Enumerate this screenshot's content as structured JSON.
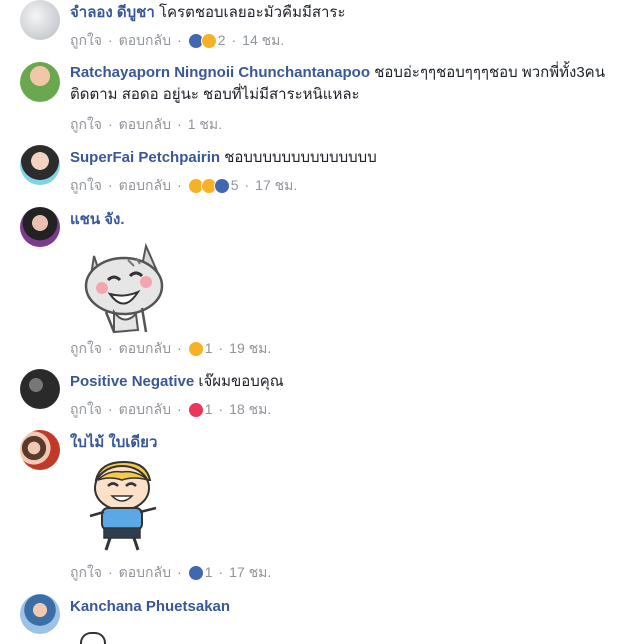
{
  "comments": [
    {
      "name": "จำลอง ดีบูชา",
      "text": "โครตชอบเลยอะมัวคืมมีสาระ",
      "like": "ถูกใจ",
      "reply": "ตอบกลับ",
      "count": "2",
      "time": "14 ชม."
    },
    {
      "name": "Ratchayaporn Ningnoii Chunchantanapoo",
      "text": "ชอบอ่ะๆๆชอบๆๆๆชอบ พวกพี่ทั้ง3คน ติดตาม สอดอ อยู่นะ ชอบที่ไม่มีสาระหนิแหละ",
      "like": "ถูกใจ",
      "reply": "ตอบกลับ",
      "time": "1 ชม."
    },
    {
      "name": "SuperFai Petchpairin",
      "text": "ชอบบบบบบบบบบบบบบ",
      "like": "ถูกใจ",
      "reply": "ตอบกลับ",
      "count": "5",
      "time": "17 ชม."
    },
    {
      "name": "แชน จัง.",
      "like": "ถูกใจ",
      "reply": "ตอบกลับ",
      "count": "1",
      "time": "19 ชม."
    },
    {
      "name": "Positive Negative",
      "text": "เจ๊ผมขอบคุณ",
      "like": "ถูกใจ",
      "reply": "ตอบกลับ",
      "count": "1",
      "time": "18 ชม."
    },
    {
      "name": "ใบไม้ ใบเดียว",
      "like": "ถูกใจ",
      "reply": "ตอบกลับ",
      "count": "1",
      "time": "17 ชม."
    },
    {
      "name": "Kanchana Phuetsakan"
    }
  ],
  "colors": {
    "name": "#385898",
    "meta": "#90949c",
    "like": "#4267b2",
    "love": "#e8375a",
    "sad": "#f7b125"
  }
}
